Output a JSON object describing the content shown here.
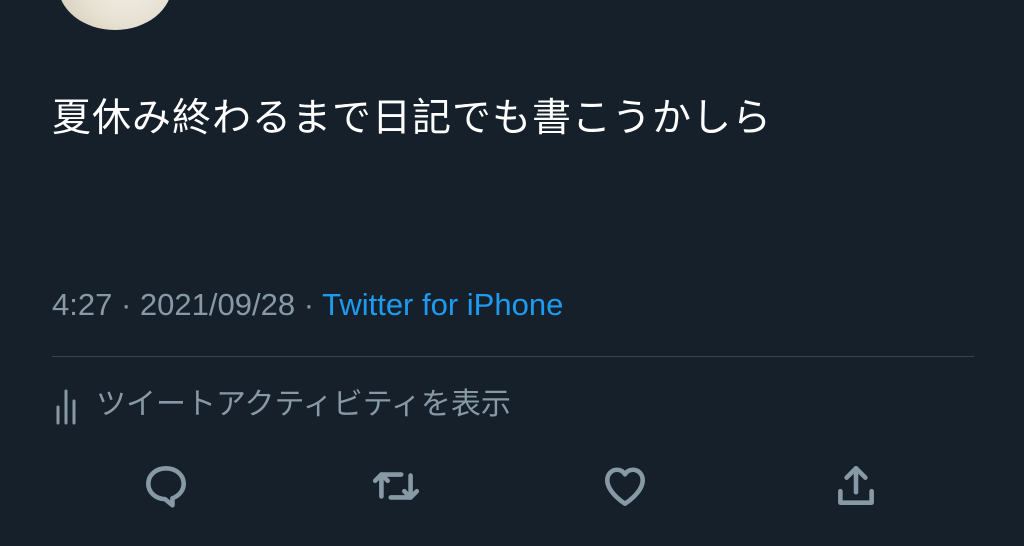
{
  "tweet": {
    "text": "夏休み終わるまで日記でも書こうかしら",
    "time": "4:27",
    "separator": "·",
    "date": "2021/09/28",
    "source": "Twitter for iPhone"
  },
  "activity": {
    "label": "ツイートアクティビティを表示",
    "icon": "bar-chart-icon"
  },
  "actions": [
    {
      "name": "reply",
      "icon": "comment-icon"
    },
    {
      "name": "retweet",
      "icon": "retweet-icon"
    },
    {
      "name": "like",
      "icon": "heart-icon"
    },
    {
      "name": "share",
      "icon": "share-icon"
    }
  ],
  "colors": {
    "background": "#15202b",
    "text": "#ffffff",
    "secondary": "#8899a6",
    "accent": "#1d9bf0",
    "divider": "#38444d"
  }
}
